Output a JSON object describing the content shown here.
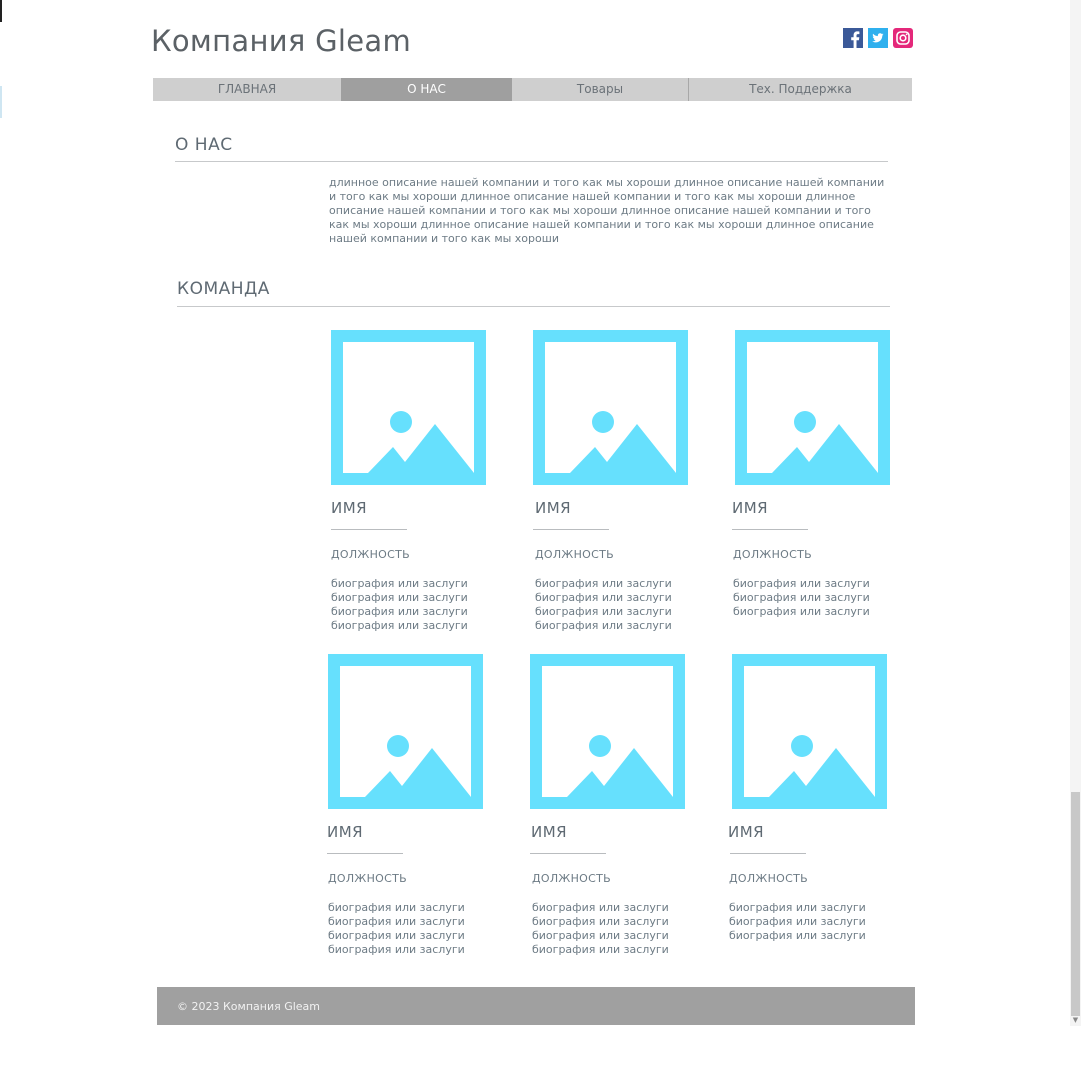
{
  "site": {
    "title": "Компания Gleam"
  },
  "social": [
    {
      "name": "facebook",
      "icon": "facebook-icon",
      "color": "#3b5998"
    },
    {
      "name": "twitter",
      "icon": "twitter-icon",
      "color": "#2fb0ee"
    },
    {
      "name": "instagram",
      "icon": "instagram-icon",
      "color": "#e4287a"
    }
  ],
  "nav": {
    "items": [
      {
        "label": "ГЛАВНАЯ",
        "active": false
      },
      {
        "label": "О НАС",
        "active": true
      },
      {
        "label": "Товары",
        "active": false
      },
      {
        "label": "Тех. Поддержка",
        "active": false
      }
    ]
  },
  "about": {
    "title": "О НАС",
    "text": "длинное описание нашей компании и того как мы хороши длинное описание нашей компании и того как мы хороши длинное описание нашей компании и того как мы хороши длинное описание нашей компании и того как мы хороши длинное описание нашей компании и того как мы хороши длинное описание нашей компании и того как мы хороши длинное описание нашей компании и того как мы хороши"
  },
  "team": {
    "title": "КОМАНДА",
    "members": [
      {
        "name": "ИМЯ",
        "role": "ДОЛЖНОСТЬ",
        "bio": [
          "биография или заслуги",
          "биография или заслуги",
          "биография или заслуги",
          "биография или заслуги"
        ]
      },
      {
        "name": "ИМЯ",
        "role": "ДОЛЖНОСТЬ",
        "bio": [
          "биография или заслуги",
          "биография или заслуги",
          "биография или заслуги",
          "биография или заслуги"
        ]
      },
      {
        "name": "ИМЯ",
        "role": "ДОЛЖНОСТЬ",
        "bio": [
          "биография или заслуги",
          "биография или заслуги",
          "биография или заслуги"
        ]
      },
      {
        "name": "ИМЯ",
        "role": "ДОЛЖНОСТЬ",
        "bio": [
          "биография или заслуги",
          "биография или заслуги",
          "биография или заслуги",
          "биография или заслуги"
        ]
      },
      {
        "name": "ИМЯ",
        "role": "ДОЛЖНОСТЬ",
        "bio": [
          "биография или заслуги",
          "биография или заслуги",
          "биография или заслуги",
          "биография или заслуги"
        ]
      },
      {
        "name": "ИМЯ",
        "role": "ДОЛЖНОСТЬ",
        "bio": [
          "биография или заслуги",
          "биография или заслуги",
          "биография или заслуги"
        ]
      }
    ]
  },
  "footer": {
    "text": "© 2023 Компания Gleam"
  },
  "colors": {
    "accent": "#66e0fd",
    "nav_bg": "#cfcfcf",
    "nav_active": "#9f9f9f",
    "footer_bg": "#a0a0a0"
  }
}
